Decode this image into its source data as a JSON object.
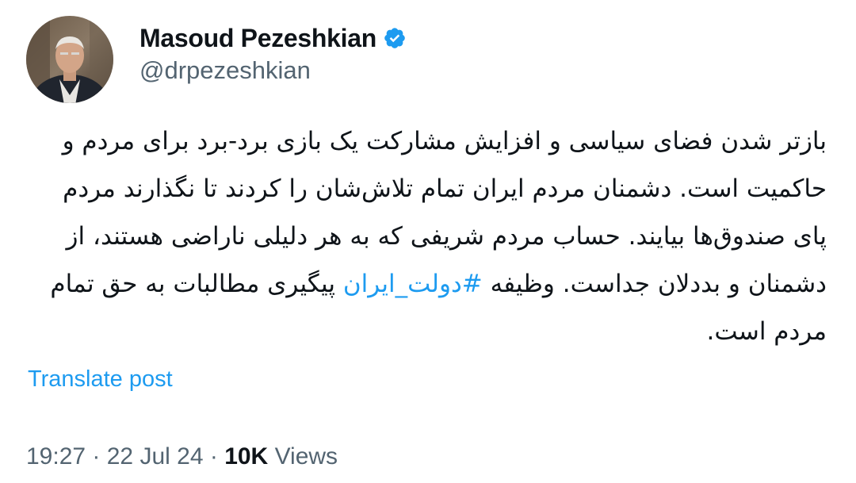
{
  "author": {
    "display_name": "Masoud Pezeshkian",
    "handle": "@drpezeshkian",
    "verified_icon": "verified-badge-icon",
    "verified_color": "#1d9bf0"
  },
  "post": {
    "text_before_hashtag": "بازتر شدن فضای سیاسی و افزایش مشارکت یک بازی برد-برد برای مردم و حاکمیت است. دشمنان مردم ایران تمام تلاش‌شان را کردند تا نگذارند مردم پای صندوق‌ها بیایند. حساب مردم شریفی که به هر دلیلی ناراضی هستند، از دشمنان و بددلان جداست. وظیفه ",
    "hashtag": "#دولت_ایران",
    "text_after_hashtag": " پیگیری مطالبات به حق تمام مردم است.",
    "translate_label": "Translate post"
  },
  "meta": {
    "time": "19:27",
    "separator": " · ",
    "date": "22 Jul 24",
    "views_count": "10K",
    "views_label": " Views"
  },
  "colors": {
    "link": "#1d9bf0",
    "secondary_text": "#536471",
    "primary_text": "#0f1419"
  }
}
